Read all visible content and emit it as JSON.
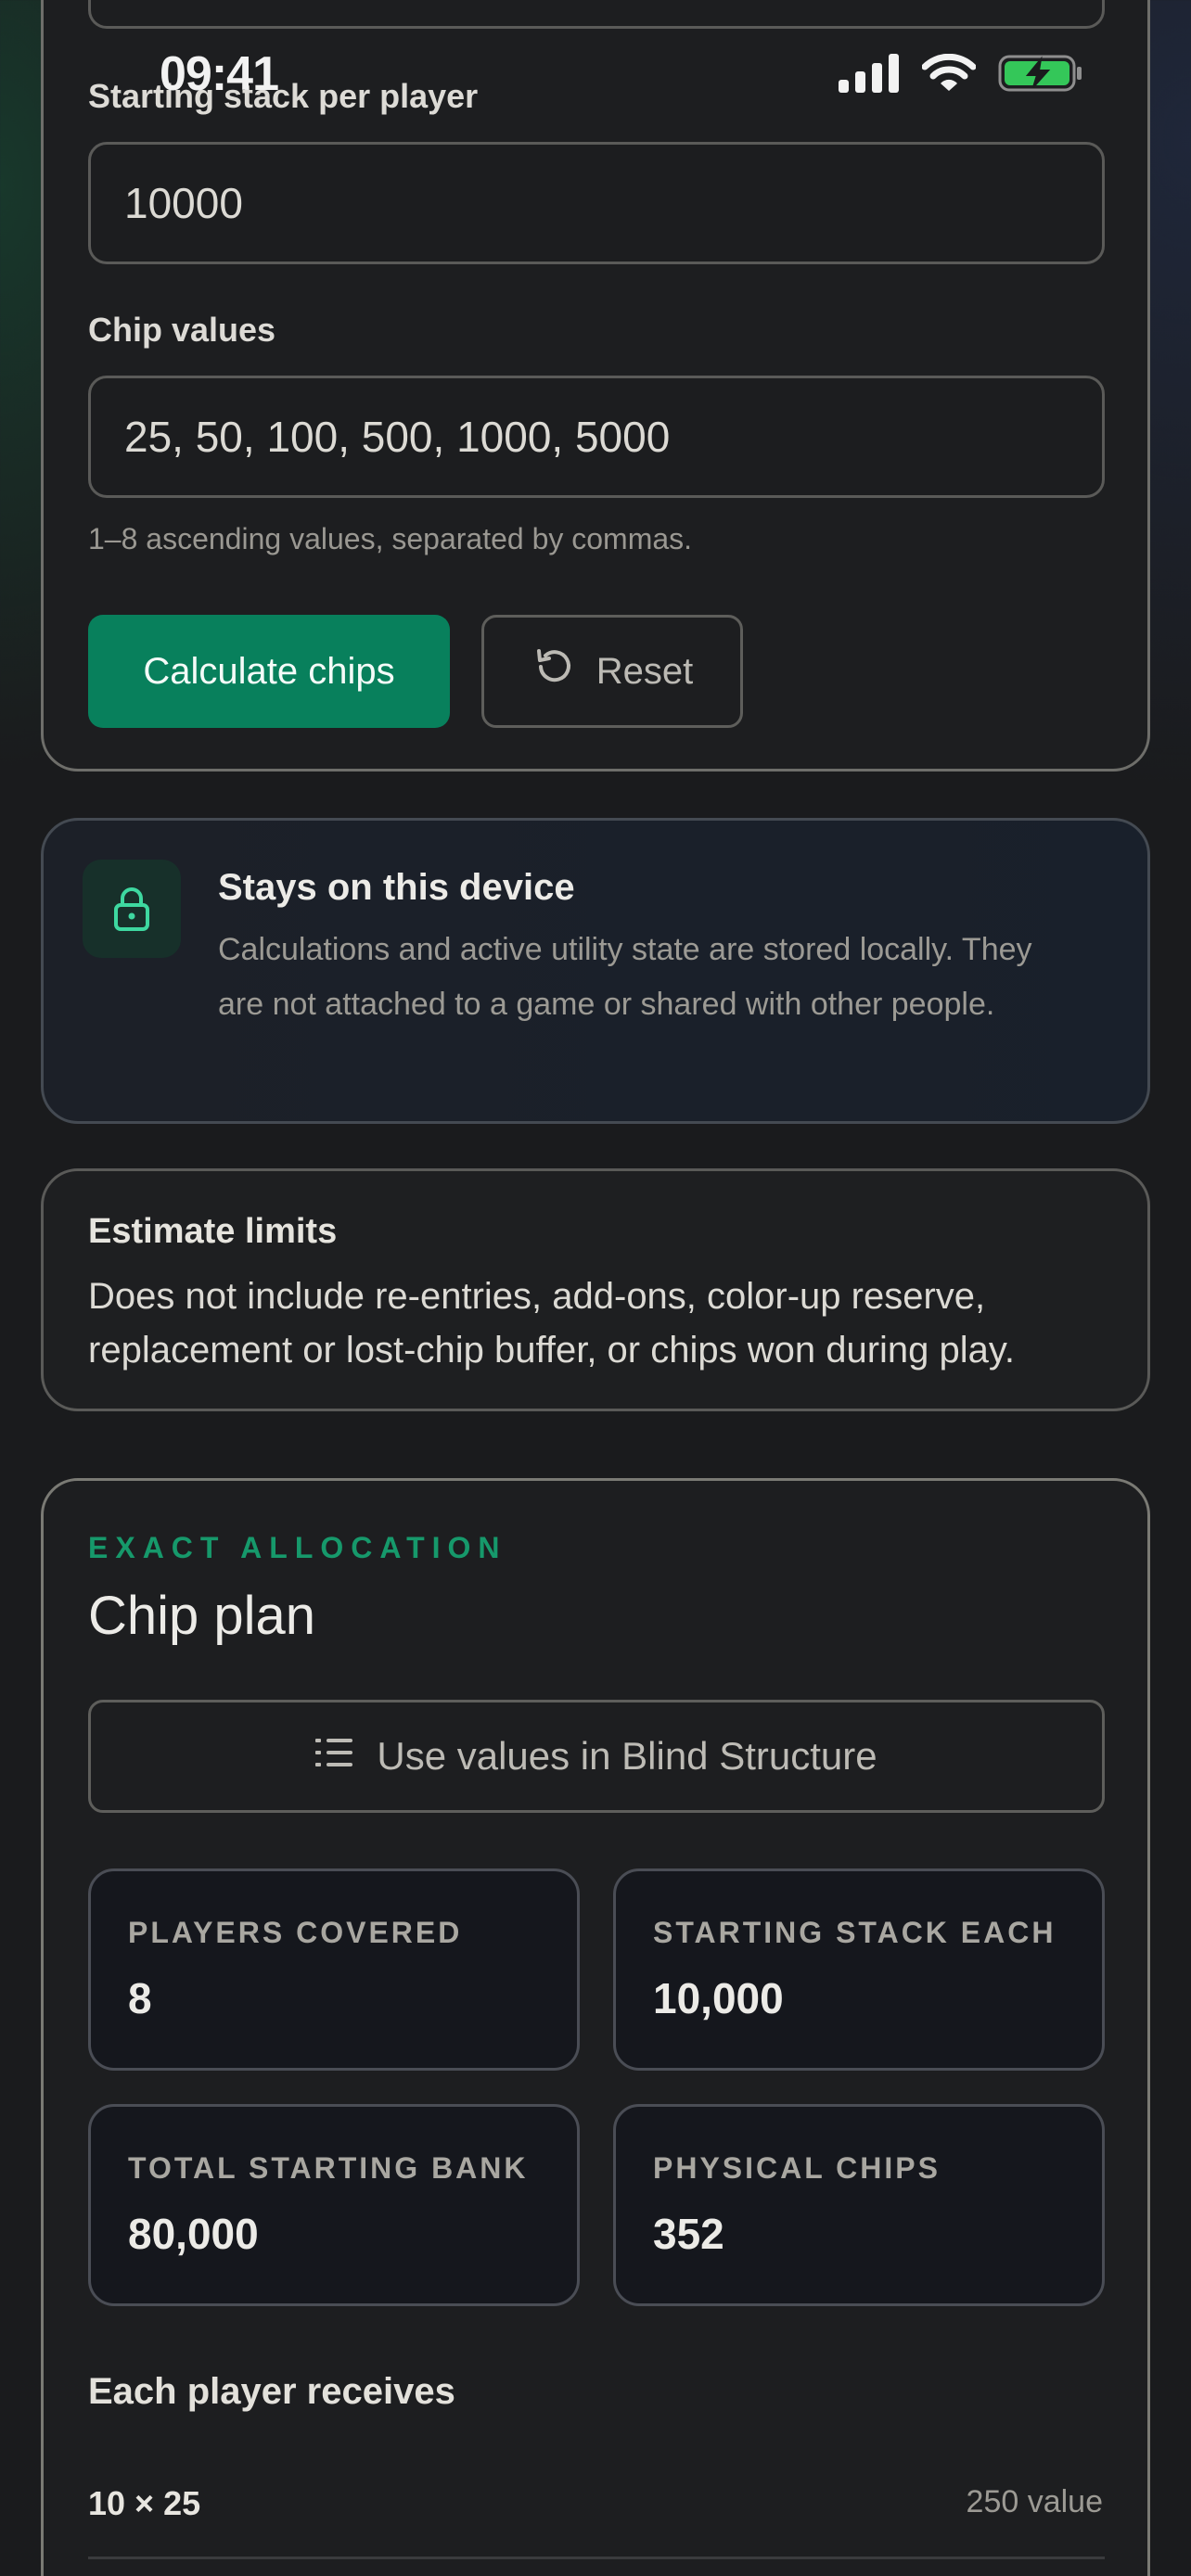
{
  "status_bar": {
    "time": "09:41",
    "icons": [
      "cellular-signal-icon",
      "wifi-icon",
      "battery-charging-icon"
    ],
    "battery_color": "#34c759"
  },
  "form": {
    "stack_label": "Starting stack per player",
    "stack_value": "10000",
    "chips_label": "Chip values",
    "chips_value": "25, 50, 100, 500, 1000, 5000",
    "chips_hint": "1–8 ascending values, separated by commas.",
    "calculate_label": "Calculate chips",
    "reset_label": "Reset",
    "reset_icon": "reset-icon"
  },
  "privacy": {
    "icon": "lock-icon",
    "title": "Stays on this device",
    "body": "Calculations and active utility state are stored locally. They are not attached to a game or shared with other people."
  },
  "limits": {
    "title": "Estimate limits",
    "body": "Does not include re-entries, add-ons, color-up reserve, replacement or lost-chip buffer, or chips won during play."
  },
  "plan": {
    "eyebrow": "EXACT ALLOCATION",
    "title": "Chip plan",
    "use_values_label": "Use values in Blind Structure",
    "use_values_icon": "list-icon",
    "stats": [
      {
        "label": "PLAYERS COVERED",
        "value": "8"
      },
      {
        "label": "STARTING STACK EACH",
        "value": "10,000"
      },
      {
        "label": "TOTAL STARTING BANK",
        "value": "80,000"
      },
      {
        "label": "PHYSICAL CHIPS",
        "value": "352"
      }
    ],
    "receives_title": "Each player receives",
    "rows": [
      {
        "qty": "10 × 25",
        "value": "250 value"
      }
    ]
  },
  "colors": {
    "accent": "#08805c",
    "eyebrow": "#16996b",
    "background": "#1a1b1d"
  }
}
